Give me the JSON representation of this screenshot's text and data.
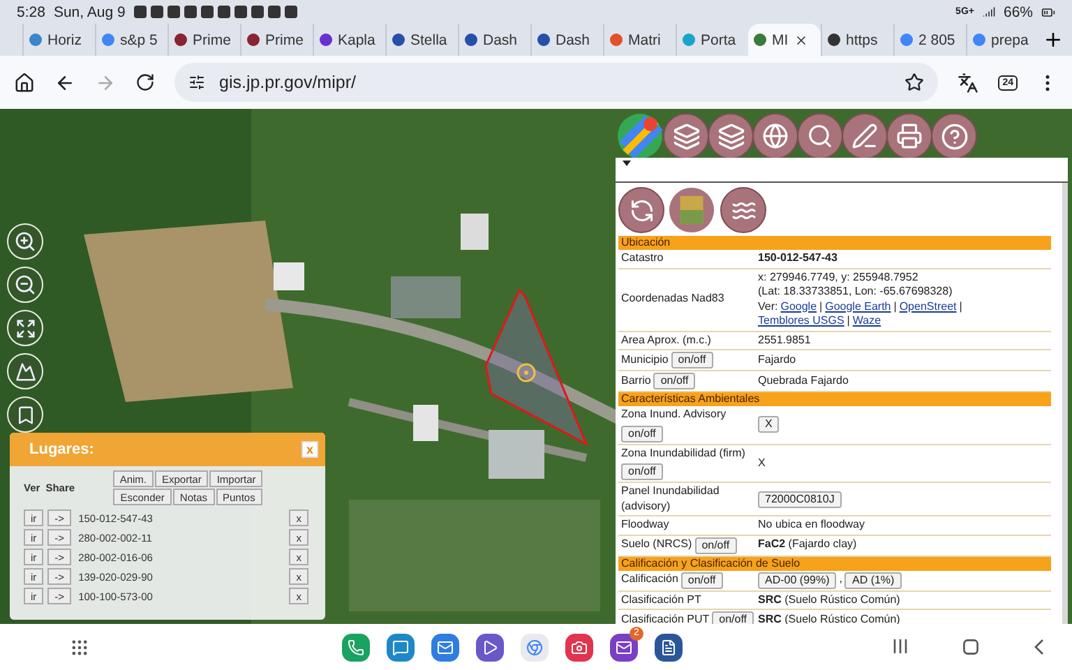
{
  "status_bar": {
    "time": "5:28",
    "date": "Sun, Aug 9",
    "network": "5G+",
    "battery": "66%"
  },
  "tabs": [
    {
      "title": "Horiz",
      "color": "#3a86c8",
      "selected": false
    },
    {
      "title": "s&p 5",
      "color": "#4285f4",
      "selected": false
    },
    {
      "title": "Prime",
      "color": "#8a2432",
      "selected": false
    },
    {
      "title": "Prime",
      "color": "#8a2432",
      "selected": false
    },
    {
      "title": "Kapla",
      "color": "#6a2fd0",
      "selected": false
    },
    {
      "title": "Stella",
      "color": "#2450a8",
      "selected": false
    },
    {
      "title": "Dash",
      "color": "#2450a8",
      "selected": false
    },
    {
      "title": "Dash",
      "color": "#2450a8",
      "selected": false
    },
    {
      "title": "Matri",
      "color": "#e0522a",
      "selected": false
    },
    {
      "title": "Porta",
      "color": "#1aa5c8",
      "selected": false
    },
    {
      "title": "MI",
      "color": "#3b7a3a",
      "selected": true
    },
    {
      "title": "https",
      "color": "#333333",
      "selected": false
    },
    {
      "title": "2 805",
      "color": "#4285f4",
      "selected": false
    },
    {
      "title": "prepa",
      "color": "#4285f4",
      "selected": false
    }
  ],
  "address_bar": {
    "url": "gis.jp.pr.gov/mipr/",
    "tab_count": "24"
  },
  "info_panel": {
    "rows": [
      {
        "kind": "section",
        "label": "Ubicación"
      },
      {
        "kind": "row",
        "label": "Catastro",
        "value": [
          {
            "kind": "text",
            "text": "**150-012-547-43**"
          }
        ]
      },
      {
        "kind": "row",
        "label": "Coordenadas Nad83",
        "value": [
          {
            "kind": "text",
            "text": "x: 279946.7749, y: 255948.7952"
          },
          {
            "kind": "text",
            "text": "(Lat: 18.33733851, Lon: -65.67698328)"
          },
          {
            "kind": "links",
            "prefix": "Ver:",
            "separator": "|",
            "links": [
              "Google",
              "Google Earth",
              "OpenStreet",
              "Temblores USGS",
              "Waze"
            ]
          }
        ]
      },
      {
        "kind": "row",
        "label": "Area Aprox. (m.c.)",
        "value": [
          {
            "kind": "text",
            "text": "2551.9851"
          }
        ]
      },
      {
        "kind": "row",
        "label": "Municipio",
        "toggle": "on/off",
        "value": [
          {
            "kind": "text",
            "text": "Fajardo"
          }
        ]
      },
      {
        "kind": "row",
        "label": "Barrio",
        "toggle": "on/off",
        "value": [
          {
            "kind": "text",
            "text": "Quebrada Fajardo"
          }
        ]
      },
      {
        "kind": "section",
        "label": "Características Ambientales"
      },
      {
        "kind": "row",
        "label": "Zona Inund. Advisory",
        "toggle": "on/off",
        "value": [
          {
            "kind": "button",
            "text": "X"
          }
        ]
      },
      {
        "kind": "row",
        "label": "Zona Inundabilidad (firm)",
        "toggle": "on/off",
        "value": [
          {
            "kind": "text",
            "text": "X"
          }
        ]
      },
      {
        "kind": "row",
        "label": "Panel Inundabilidad (advisory)",
        "value": [
          {
            "kind": "button",
            "text": "72000C0810J"
          }
        ]
      },
      {
        "kind": "row",
        "label": "Floodway",
        "value": [
          {
            "kind": "text",
            "text": "No ubica en floodway"
          }
        ]
      },
      {
        "kind": "row",
        "label": "Suelo (NRCS)",
        "toggle": "on/off",
        "value": [
          {
            "kind": "text",
            "text": "**FaC2** (Fajardo clay)"
          }
        ]
      },
      {
        "kind": "section",
        "label": "Calificación y Clasificación de Suelo"
      },
      {
        "kind": "row",
        "label": "Calificación",
        "toggle": "on/off",
        "value": [
          {
            "kind": "button",
            "text": "AD-00 (99%)"
          },
          {
            "kind": "sep",
            "text": ","
          },
          {
            "kind": "button",
            "text": "AD (1%)"
          }
        ]
      },
      {
        "kind": "row",
        "label": "Clasificación PT",
        "value": [
          {
            "kind": "text",
            "text": "**SRC** (Suelo Rústico Común)"
          }
        ]
      },
      {
        "kind": "row",
        "label": "Clasificación PUT",
        "toggle": "on/off",
        "value": [
          {
            "kind": "text",
            "text": "**SRC** (Suelo Rústico Común)"
          }
        ]
      }
    ]
  },
  "lugares": {
    "title": "Lugares:",
    "close": "x",
    "columns": [
      "Ver",
      "Share"
    ],
    "actions": [
      "Anim.",
      "Exportar",
      "Importar",
      "Esconder",
      "Notas",
      "Puntos"
    ],
    "rows": [
      {
        "go": "ir",
        "share": "->",
        "id": "150-012-547-43",
        "remove": "x"
      },
      {
        "go": "ir",
        "share": "->",
        "id": "280-002-002-11",
        "remove": "x"
      },
      {
        "go": "ir",
        "share": "->",
        "id": "280-002-016-06",
        "remove": "x"
      },
      {
        "go": "ir",
        "share": "->",
        "id": "139-020-029-90",
        "remove": "x"
      },
      {
        "go": "ir",
        "share": "->",
        "id": "100-100-573-00",
        "remove": "x"
      }
    ]
  },
  "dock": {
    "apps": [
      {
        "color": "#1aa260"
      },
      {
        "color": "#1e88c7"
      },
      {
        "color": "#2f7de1"
      },
      {
        "color": "#6a58c8"
      },
      {
        "color": "#e8eaed"
      },
      {
        "color": "#e0344f"
      },
      {
        "color": "#7b3fc4",
        "badge": "2"
      },
      {
        "color": "#2b579a"
      }
    ]
  }
}
